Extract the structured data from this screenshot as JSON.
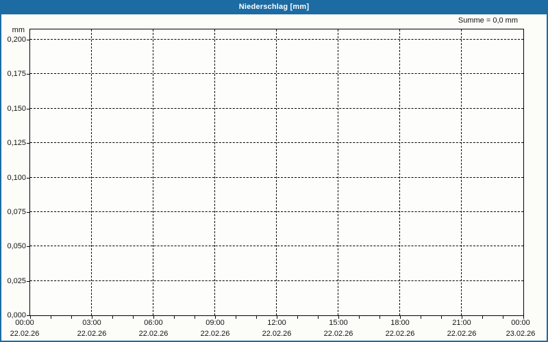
{
  "window": {
    "title": "Niederschlag [mm]",
    "summary_label": "Summe = 0,0 mm"
  },
  "colors": {
    "titlebar_bg": "#1d6ba3",
    "titlebar_text": "#ffffff",
    "window_border": "#1d6ba3",
    "background": "#fcfdf9",
    "plot_background": "#fdfefb",
    "grid": "#000000",
    "axis_text": "#111111"
  },
  "y_axis": {
    "unit": "mm",
    "ticks": [
      {
        "label": "0,200",
        "value": 0.2
      },
      {
        "label": "0,175",
        "value": 0.175
      },
      {
        "label": "0,150",
        "value": 0.15
      },
      {
        "label": "0,125",
        "value": 0.125
      },
      {
        "label": "0,100",
        "value": 0.1
      },
      {
        "label": "0,075",
        "value": 0.075
      },
      {
        "label": "0,050",
        "value": 0.05
      },
      {
        "label": "0,025",
        "value": 0.025
      },
      {
        "label": "0,000",
        "value": 0.0
      }
    ]
  },
  "x_axis": {
    "hours_range": [
      0,
      24
    ],
    "minor_tick_every_hours": 1,
    "major_tick_every_hours": 3,
    "ticks": [
      {
        "time": "00:00",
        "date": "22.02.26",
        "hour": 0
      },
      {
        "time": "03:00",
        "date": "22.02.26",
        "hour": 3
      },
      {
        "time": "06:00",
        "date": "22.02.26",
        "hour": 6
      },
      {
        "time": "09:00",
        "date": "22.02.26",
        "hour": 9
      },
      {
        "time": "12:00",
        "date": "22.02.26",
        "hour": 12
      },
      {
        "time": "15:00",
        "date": "22.02.26",
        "hour": 15
      },
      {
        "time": "18:00",
        "date": "22.02.26",
        "hour": 18
      },
      {
        "time": "21:00",
        "date": "22.02.26",
        "hour": 21
      },
      {
        "time": "00:00",
        "date": "23.02.26",
        "hour": 24
      }
    ]
  },
  "chart_data": {
    "type": "bar",
    "title": "Niederschlag [mm]",
    "ylabel": "mm",
    "xlabel": "",
    "ylim": [
      0.0,
      0.208
    ],
    "y_tick_values": [
      0.0,
      0.025,
      0.05,
      0.075,
      0.1,
      0.125,
      0.15,
      0.175,
      0.2
    ],
    "x_tick_labels": [
      "00:00 22.02.26",
      "03:00 22.02.26",
      "06:00 22.02.26",
      "09:00 22.02.26",
      "12:00 22.02.26",
      "15:00 22.02.26",
      "18:00 22.02.26",
      "21:00 22.02.26",
      "00:00 23.02.26"
    ],
    "grid": true,
    "legend_position": "none",
    "series": [
      {
        "name": "Niederschlag",
        "unit": "mm",
        "values": [],
        "sum": 0.0
      }
    ],
    "annotations": [
      {
        "text": "Summe = 0,0 mm",
        "position": "top-right"
      }
    ]
  }
}
